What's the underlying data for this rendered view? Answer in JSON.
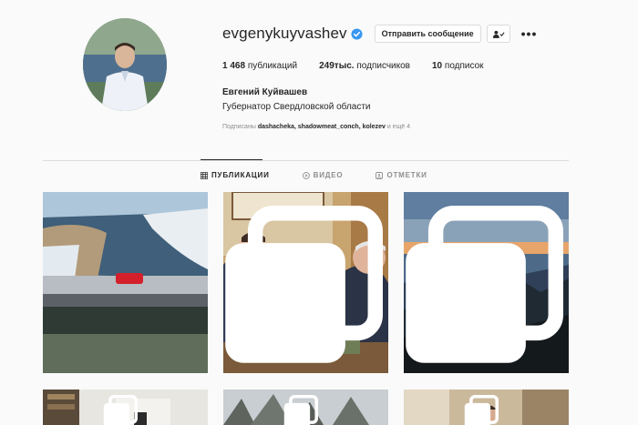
{
  "profile": {
    "username": "evgenykuyvashev",
    "message_button": "Отправить сообщение",
    "more_label": "•••",
    "full_name": "Евгений Куйвашев",
    "bio": "Губернатор Свердловской области",
    "followed_by_prefix": "Подписаны",
    "followed_by_users": "dashacheka, shadowmeat_conch, kolezev",
    "followed_by_suffix": "и ещё 4",
    "verified_color": "#3897f0"
  },
  "stats": {
    "posts_value": "1 468",
    "posts_label": "публикаций",
    "followers_value": "249тыс.",
    "followers_label": "подписчиков",
    "following_value": "10",
    "following_label": "подписок"
  },
  "tabs": [
    {
      "label": "ПУБЛИКАЦИИ",
      "icon": "grid-icon",
      "active": true
    },
    {
      "label": "ВИДЕО",
      "icon": "video-icon",
      "active": false
    },
    {
      "label": "ОТМЕТКИ",
      "icon": "tagged-icon",
      "active": false
    }
  ],
  "posts": [
    {
      "subject": "river-bridge-photo",
      "multi": false
    },
    {
      "subject": "meeting-photo",
      "multi": true
    },
    {
      "subject": "mountain-sunset-photo",
      "multi": true
    },
    {
      "subject": "office-photo",
      "multi": true
    },
    {
      "subject": "trees-photo",
      "multi": true
    },
    {
      "subject": "man-portrait-photo",
      "multi": true
    }
  ]
}
